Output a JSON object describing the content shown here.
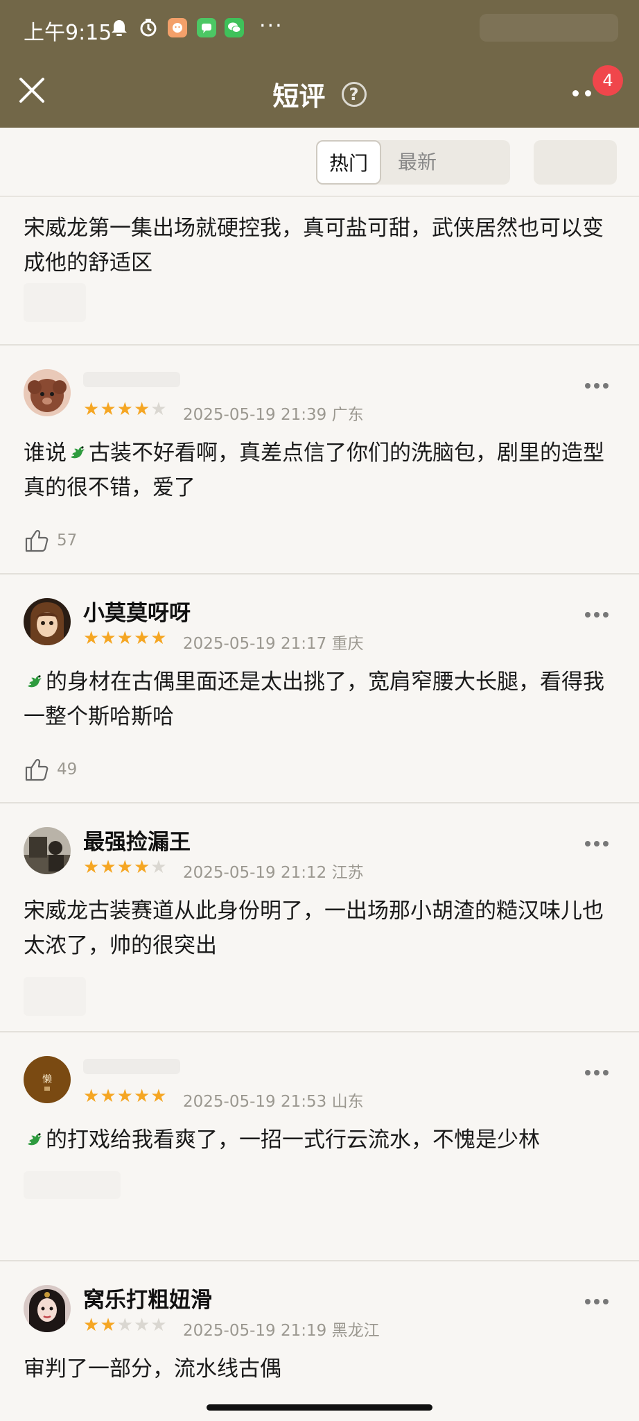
{
  "status_bar": {
    "time": "上午9:15",
    "dots": "···"
  },
  "header": {
    "title": "短评",
    "help_glyph": "?",
    "badge_count": "4"
  },
  "tabs": {
    "hot_label": "热门",
    "latest_label": "最新",
    "active": "热门"
  },
  "colors": {
    "header_bg": "#726748",
    "star_on": "#f5a623",
    "badge": "#f0464b"
  },
  "reviews": [
    {
      "user": "",
      "rating": null,
      "meta": "",
      "text": "宋威龙第一集出场就硬控我，真可盐可甜，武侠居然也可以变成他的舒适区",
      "likes": ""
    },
    {
      "user": "",
      "rating": 4,
      "meta": "2025-05-19 21:39 广东",
      "text_before_emoji": "谁说",
      "text": "古装不好看啊，真差点信了你们的洗脑包，剧里的造型真的很不错，爱了",
      "likes": "57",
      "avatar_icon": "puppy-avatar"
    },
    {
      "user": "小莫莫呀呀",
      "rating": 5,
      "meta": "2025-05-19 21:17 重庆",
      "text": "的身材在古偶里面还是太出挑了，宽肩窄腰大长腿，看得我一整个斯哈斯哈",
      "likes": "49",
      "avatar_icon": "anime-girl-avatar"
    },
    {
      "user": "最强捡漏王",
      "rating": 4,
      "meta": "2025-05-19 21:12 江苏",
      "text": "宋威龙古装赛道从此身份明了，一出场那小胡渣的糙汉味儿也太浓了，帅的很突出",
      "likes": "",
      "avatar_icon": "photo-avatar"
    },
    {
      "user": "",
      "rating": 5,
      "meta": "2025-05-19 21:53 山东",
      "text": "的打戏给我看爽了，一招一式行云流水，不愧是少林",
      "likes": "",
      "avatar_icon": "seal-avatar",
      "avatar_glyph": "懒"
    },
    {
      "user": "窝乐打粗妞滑",
      "rating": 2,
      "meta": "2025-05-19 21:19 黑龙江",
      "text": "审判了一部分，流水线古偶",
      "likes": "",
      "avatar_icon": "portrait-avatar"
    }
  ]
}
